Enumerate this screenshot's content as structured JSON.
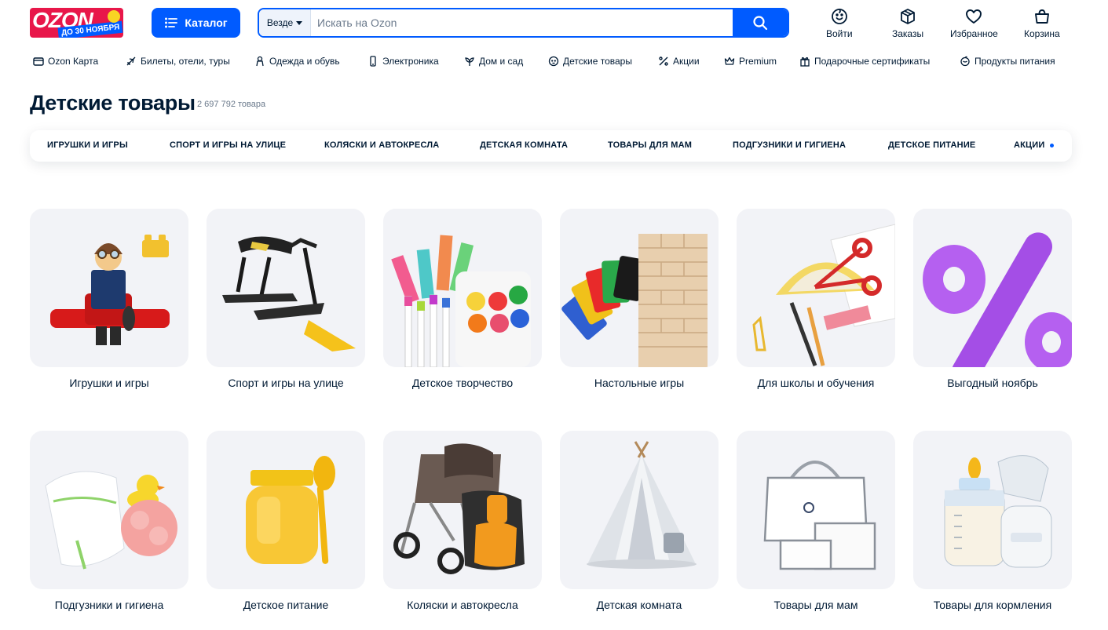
{
  "header": {
    "logo_text": "OZON",
    "logo_badge": "ДО 30 НОЯБРЯ",
    "catalog_label": "Каталог",
    "search_scope": "Везде",
    "search_placeholder": "Искать на Ozon",
    "actions": [
      {
        "label": "Войти",
        "icon": "smile-icon"
      },
      {
        "label": "Заказы",
        "icon": "box-icon"
      },
      {
        "label": "Избранное",
        "icon": "heart-icon"
      },
      {
        "label": "Корзина",
        "icon": "cart-icon"
      }
    ]
  },
  "nav": [
    {
      "label": "Ozon Карта",
      "icon": "card-icon"
    },
    {
      "label": "Билеты, отели, туры",
      "icon": "plane-icon"
    },
    {
      "label": "Одежда и обувь",
      "icon": "clothes-icon"
    },
    {
      "label": "Электроника",
      "icon": "phone-icon"
    },
    {
      "label": "Дом и сад",
      "icon": "plant-icon"
    },
    {
      "label": "Детские товары",
      "icon": "baby-icon"
    },
    {
      "label": "Акции",
      "icon": "percent-icon"
    },
    {
      "label": "Premium",
      "icon": "crown-icon"
    },
    {
      "label": "Подарочные сертификаты",
      "icon": "gift-icon"
    },
    {
      "label": "Продукты питания",
      "icon": "food-icon"
    }
  ],
  "page": {
    "title": "Детские товары",
    "count": "2 697 792 товара"
  },
  "tabs": [
    "ИГРУШКИ И ИГРЫ",
    "СПОРТ И ИГРЫ НА УЛИЦЕ",
    "КОЛЯСКИ И АВТОКРЕСЛА",
    "ДЕТСКАЯ КОМНАТА",
    "ТОВАРЫ ДЛЯ МАМ",
    "ПОДГУЗНИКИ И ГИГИЕНА",
    "ДЕТСКОЕ ПИТАНИЕ",
    "АКЦИИ"
  ],
  "categories": [
    {
      "label": "Игрушки и игры",
      "image": "lego-figure"
    },
    {
      "label": "Спорт и игры на улице",
      "image": "snow-scooter"
    },
    {
      "label": "Детское творчество",
      "image": "paints-markers"
    },
    {
      "label": "Настольные игры",
      "image": "cards-jenga"
    },
    {
      "label": "Для школы и обучения",
      "image": "school-supplies"
    },
    {
      "label": "Выгодный ноябрь",
      "image": "percent-sign"
    },
    {
      "label": "Подгузники и гигиена",
      "image": "diapers-duck"
    },
    {
      "label": "Детское питание",
      "image": "baby-food-jar"
    },
    {
      "label": "Коляски и автокресла",
      "image": "stroller-carseat"
    },
    {
      "label": "Детская комната",
      "image": "teepee-tent"
    },
    {
      "label": "Товары для мам",
      "image": "clear-bags"
    },
    {
      "label": "Товары для кормления",
      "image": "bottle-pump"
    }
  ],
  "colors": {
    "brand_blue": "#005bff",
    "brand_pink": "#e8174a",
    "text": "#001a34",
    "card_bg": "#f2f3f7"
  }
}
